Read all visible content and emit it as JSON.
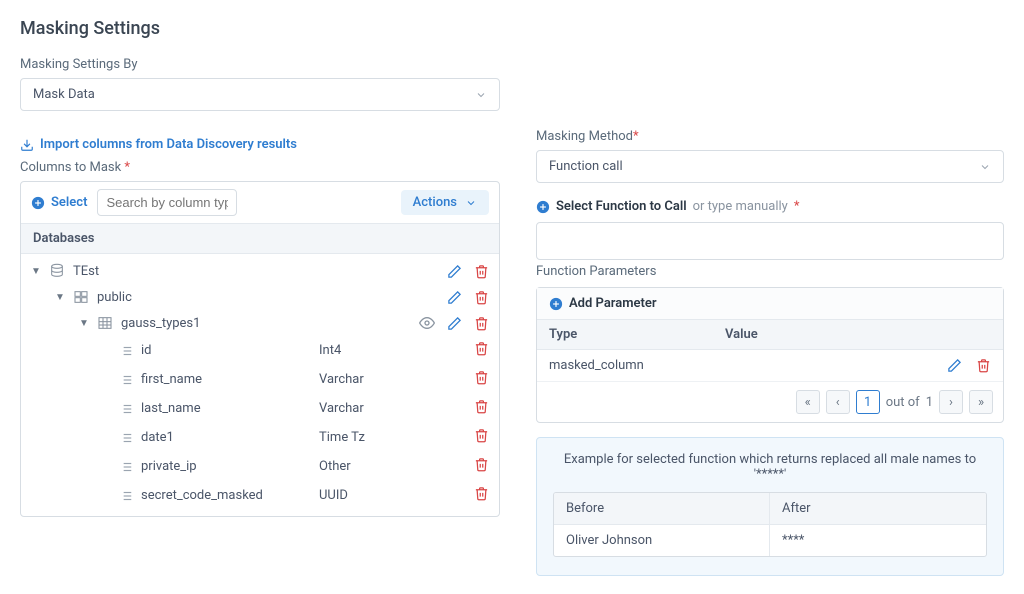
{
  "title": "Masking Settings",
  "settings_by_label": "Masking Settings By",
  "settings_by_value": "Mask Data",
  "import_link": "Import columns from Data Discovery results",
  "columns_label": "Columns to Mask",
  "toolbar": {
    "select_label": "Select",
    "search_placeholder": "Search by column type",
    "actions_label": "Actions"
  },
  "databases_header": "Databases",
  "tree": {
    "db": "TEst",
    "schema": "public",
    "table": "gauss_types1",
    "columns": [
      {
        "name": "id",
        "type": "Int4"
      },
      {
        "name": "first_name",
        "type": "Varchar"
      },
      {
        "name": "last_name",
        "type": "Varchar"
      },
      {
        "name": "date1",
        "type": "Time Tz"
      },
      {
        "name": "private_ip",
        "type": "Other"
      },
      {
        "name": "secret_code_masked",
        "type": "UUID"
      }
    ]
  },
  "method_label": "Masking Method",
  "method_value": "Function call",
  "fn_select_strong": "Select Function to Call",
  "fn_select_hint": "or type manually",
  "fn_params_label": "Function Parameters",
  "add_param_label": "Add Parameter",
  "param_th_type": "Type",
  "param_th_value": "Value",
  "param_rows": [
    {
      "type": "masked_column",
      "value": ""
    }
  ],
  "pager": {
    "current": "1",
    "out_of_label": "out of",
    "total": "1"
  },
  "example": {
    "title": "Example for selected function which returns replaced all male names to '*****'",
    "before_label": "Before",
    "after_label": "After",
    "before_value": "Oliver Johnson",
    "after_value": "****"
  }
}
